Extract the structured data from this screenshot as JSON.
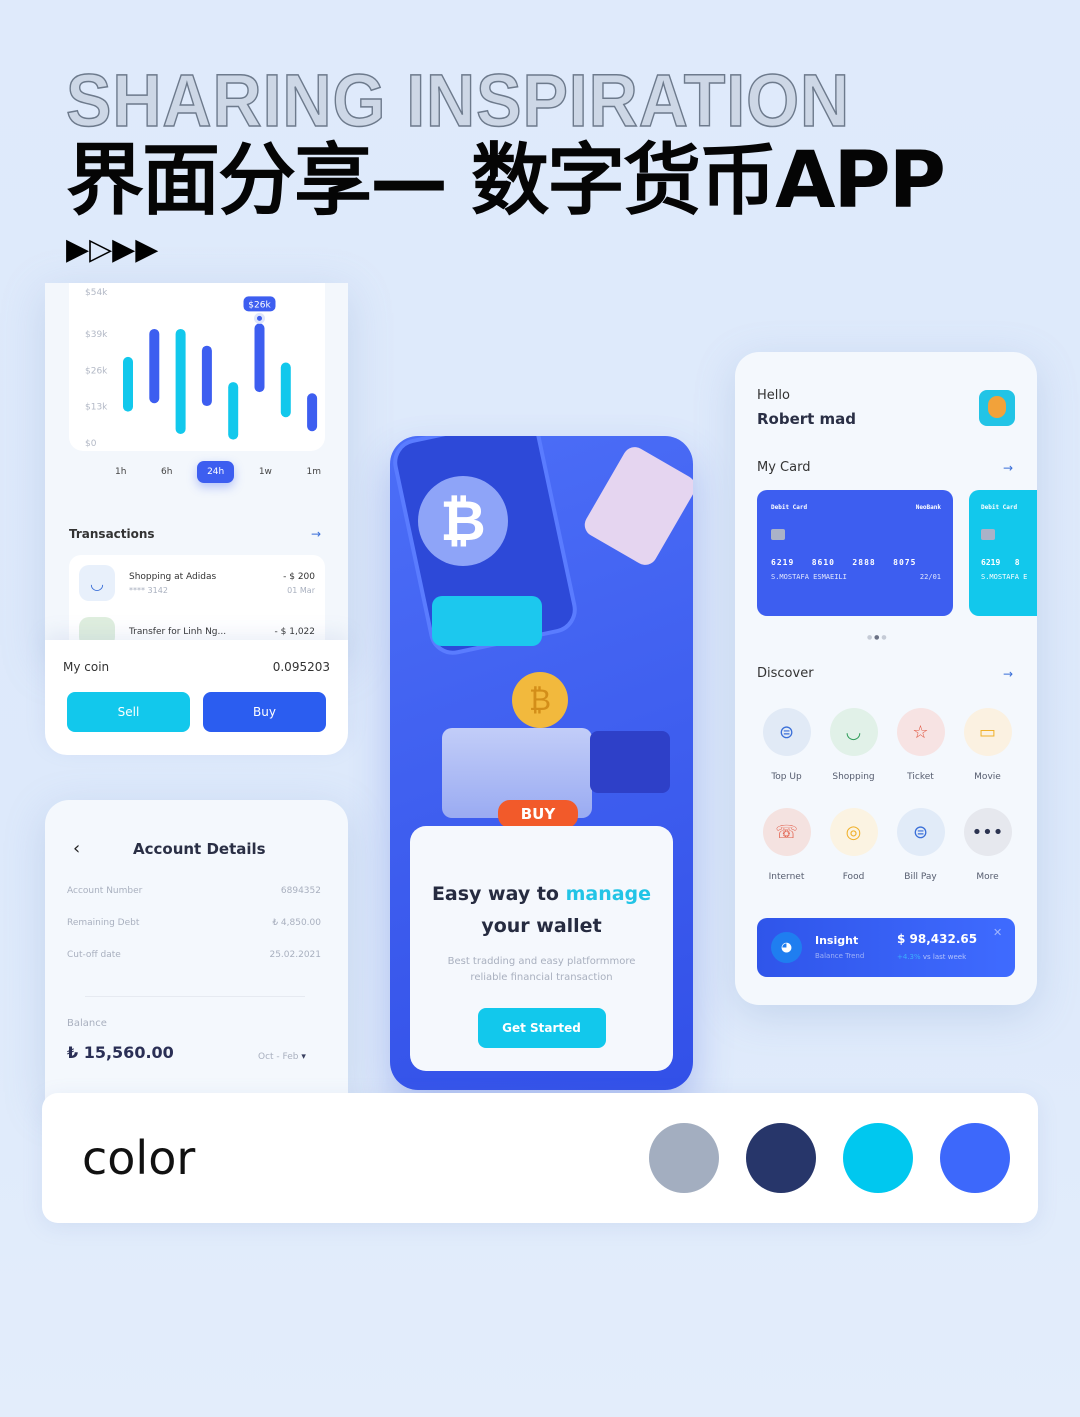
{
  "header": {
    "outline_title": "SHARING INSPIRATION",
    "title": "界面分享— 数字货币APP",
    "arrows": "▶▷▶▶"
  },
  "chart_card": {
    "chart_data": {
      "type": "bar",
      "subtype": "range",
      "yticks": [
        "$0",
        "$13k",
        "$26k",
        "$39k",
        "$54k"
      ],
      "ylim": [
        0,
        54
      ],
      "ranges": [
        [
          13,
          29
        ],
        [
          16,
          39
        ],
        [
          5,
          39
        ],
        [
          15,
          33
        ],
        [
          3,
          20
        ],
        [
          20,
          41
        ],
        [
          11,
          27
        ],
        [
          6,
          16
        ]
      ],
      "colors": [
        "#12c8ec",
        "#3d5ef0",
        "#12c8ec",
        "#3d5ef0",
        "#12c8ec",
        "#3d5ef0",
        "#12c8ec",
        "#3d5ef0"
      ],
      "tooltip": "$26k",
      "tooltip_bar": 5
    },
    "time_tabs": [
      "1h",
      "6h",
      "24h",
      "1w",
      "1m"
    ],
    "active_tab": "24h",
    "transactions_title": "Transactions",
    "transactions": [
      {
        "title": "Shopping at Adidas",
        "sub": "**** 3142",
        "amount": "- $ 200",
        "date": "01 Mar"
      },
      {
        "title": "Transfer for Linh Ng...",
        "amount": "- $ 1,022"
      }
    ],
    "coin_label": "My coin",
    "coin_value": "0.095203",
    "sell": "Sell",
    "buy": "Buy"
  },
  "account": {
    "title": "Account Details",
    "rows": [
      {
        "label": "Account Number",
        "value": "6894352"
      },
      {
        "label": "Remaining Debt",
        "value": "₺ 4,850.00"
      },
      {
        "label": "Cut-off date",
        "value": "25.02.2021"
      }
    ],
    "balance_label": "Balance",
    "balance": "₺ 15,560.00",
    "period": "Oct - Feb"
  },
  "onboarding": {
    "badge": "BUY",
    "headline_a": "Easy way to ",
    "headline_b": "manage",
    "headline_c": "your wallet",
    "desc": "Best tradding and easy platformmore reliable financial transaction",
    "cta": "Get Started"
  },
  "home": {
    "greeting": "Hello",
    "name": "Robert mad",
    "my_card": "My Card",
    "cards": [
      {
        "type": "Debit Card",
        "bank": "NeoBank",
        "number": "6219   8610   2888   8075",
        "holder": "S.MOSTAFA ESMAEILI",
        "exp": "22/01",
        "color": "#3d5ef0"
      },
      {
        "type": "Debit Card",
        "number": "6219   8",
        "holder": "S.MOSTAFA E",
        "color": "#12c8ec"
      }
    ],
    "discover": "Discover",
    "services": [
      {
        "label": "Top Up",
        "icon": "topup-icon",
        "glyph": "⊜",
        "bg": "#e1eaf6",
        "fg": "#3a6fd8"
      },
      {
        "label": "Shopping",
        "icon": "shopping-bag-icon",
        "glyph": "◡",
        "bg": "#e1f1e8",
        "fg": "#2f9d5a"
      },
      {
        "label": "Ticket",
        "icon": "star-icon",
        "glyph": "☆",
        "bg": "#f7e3e3",
        "fg": "#e0553f"
      },
      {
        "label": "Movie",
        "icon": "camera-icon",
        "glyph": "▭",
        "bg": "#fbf1e1",
        "fg": "#f0b12c"
      },
      {
        "label": "Internet",
        "icon": "phone-icon",
        "glyph": "☏",
        "bg": "#f4e2e0",
        "fg": "#e0553f"
      },
      {
        "label": "Food",
        "icon": "food-icon",
        "glyph": "◎",
        "bg": "#fbf3e2",
        "fg": "#f0b12c"
      },
      {
        "label": "Bill Pay",
        "icon": "bill-icon",
        "glyph": "⊜",
        "bg": "#e1ebf8",
        "fg": "#3a6fd8"
      },
      {
        "label": "More",
        "icon": "more-icon",
        "glyph": "•••",
        "bg": "#e6e8ee",
        "fg": "#2b3350"
      }
    ],
    "insight": {
      "title": "Insight",
      "sub": "Balance Trend",
      "amount": "$ 98,432.65",
      "change": "+4.3%",
      "change_suffix": " vs last week"
    }
  },
  "palette": {
    "label": "color",
    "colors": [
      "#a3aec0",
      "#27366a",
      "#00c8ef",
      "#3d68fb"
    ]
  }
}
